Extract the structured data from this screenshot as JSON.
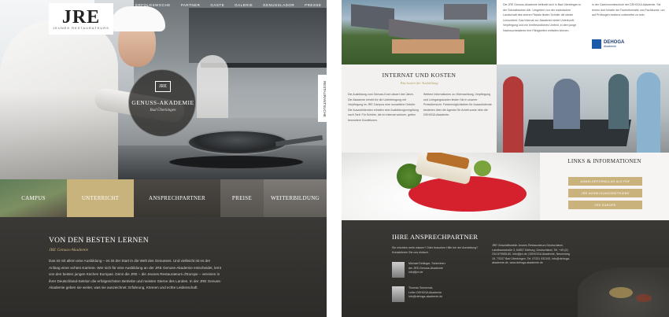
{
  "left": {
    "logo": {
      "mark": "JRE",
      "sub": "JEUNES RESTAURATEURS"
    },
    "nav": [
      "ERFOLGSWOCHE",
      "PARTNER",
      "GASTE",
      "GALERIE",
      "GENUSSLADOR",
      "PRESSE"
    ],
    "side_tab": "RESTAURANTSUCHE",
    "emblem": {
      "mark": "JRE",
      "title": "GENUSS-AKADEMIE",
      "subtitle": "Bad Überkingen"
    },
    "tiles": [
      "CAMPUS",
      "UNTERRICHT",
      "ANSPRECHPARTNER",
      "PREISE",
      "WEITERBILDUNG"
    ],
    "section": {
      "heading": "VON DEN BESTEN LERNEN",
      "subheading": "JRE Genuss-Akademie",
      "body": "Das ist mit allem eine Ausbildung – es ist der Start in die Welt des Genusses. Und vielleicht ist es der Anfang einer echten Karriere. Wer sich für eine Ausbildung an der JRE Genuss-Akademie entscheidet, lernt von den besten jungen Küchen Europas. Denn die JRE – die Jeunes Restaurateurs d'Europe – vereinen in ihrer Deutschland-Sektion die erfolgreichsten Betriebe und meisten Sterne des Landes. In der JRE Genuss-Akademie geben sie weiter, was sie auszeichnet: Erfahrung, Können und echte Leidenschaft."
    }
  },
  "right": {
    "top_text_1": "Die JRE Genuss-Akademie befindet sich in Bad Überkingen in der Schwäbischen Alb. Umgeben von der malerischen Landschaft des oberen Filstals finden Schüler die ideale Lernumfeld. Das Internat zur Akademie bietet Unterkunft, Verpflegung und ein lernfreundliches Umfeld, in dem junge Nachwuchstalente ihre Fähigkeiten entfalten können.",
    "top_text_2": "in der Gastronomieschule der DEHOGA Akademie. Sie lernen dort Inhalte der Fachinformatik und Fachkunde, um auf Prüfungen bestens vorbereitet zu sein.",
    "dehoga": {
      "name": "DEHOGA",
      "sub": "Akademie"
    },
    "internat": {
      "heading": "INTERNAT UND KOSTEN",
      "subheading": "Was kostet die Ausbildung",
      "col1": "Die Ausbildung zum Genuss-Koch dauert drei Jahre. Die Akademie erhebt für die Unterbringung mit Verpflegung im JRE Campus eine monatliche Gebühr. Die Auszubildenden erhalten eine Ausbildungsvergütung nach Tarif. Für Schüler, die im Internat wohnen, gelten besondere Konditionen.",
      "col2": "Weitere Informationen zu Übernachtung, Verpflegung und Lehrgangskosten finden Sie in unserer Preisübersicht. Fördermöglichkeiten für Auszubildende bestehen über die Agentur für Arbeit sowie über die DEHOGA Akademie."
    },
    "links": {
      "heading": "LINKS & INFORMATIONEN",
      "buttons": [
        "ANMELDEFORMULAR ALS PDF",
        "JRE AUSBILDUNGSBETRIEBE",
        "JRE EUROPE"
      ]
    },
    "contact": {
      "heading": "IHRE ANSPRECHPARTNER",
      "intro": "Sie möchten mehr wissen? Oder brauchen Hilfe bei der Anmeldung? Kontaktieren Sie uns einfach.",
      "persons": [
        {
          "name": "Michael Dellinger, Schirmherr",
          "role": "der JRE-Genuss-Akademie",
          "mail": "info@jre.de"
        },
        {
          "name": "Thomas Schwenck,",
          "role": "Leiter DEHOGA Akademie",
          "mail": "info@dehoga-akademie.de"
        }
      ],
      "address": "JRE Geschäftsstelle Jeunes Restaurateurs Deutschland, Landhausstraße 3, 64807 Dieburg, Deutschland, Tel. +49 (0) 234 879555-60, info@jre.de | DEHOGA Akademie, Neuenweg 19, 73337 Bad Überkingen, Tel. 07331 932100, info@dehoga-akademie.de, www.dehoga-akademie.de"
    }
  }
}
